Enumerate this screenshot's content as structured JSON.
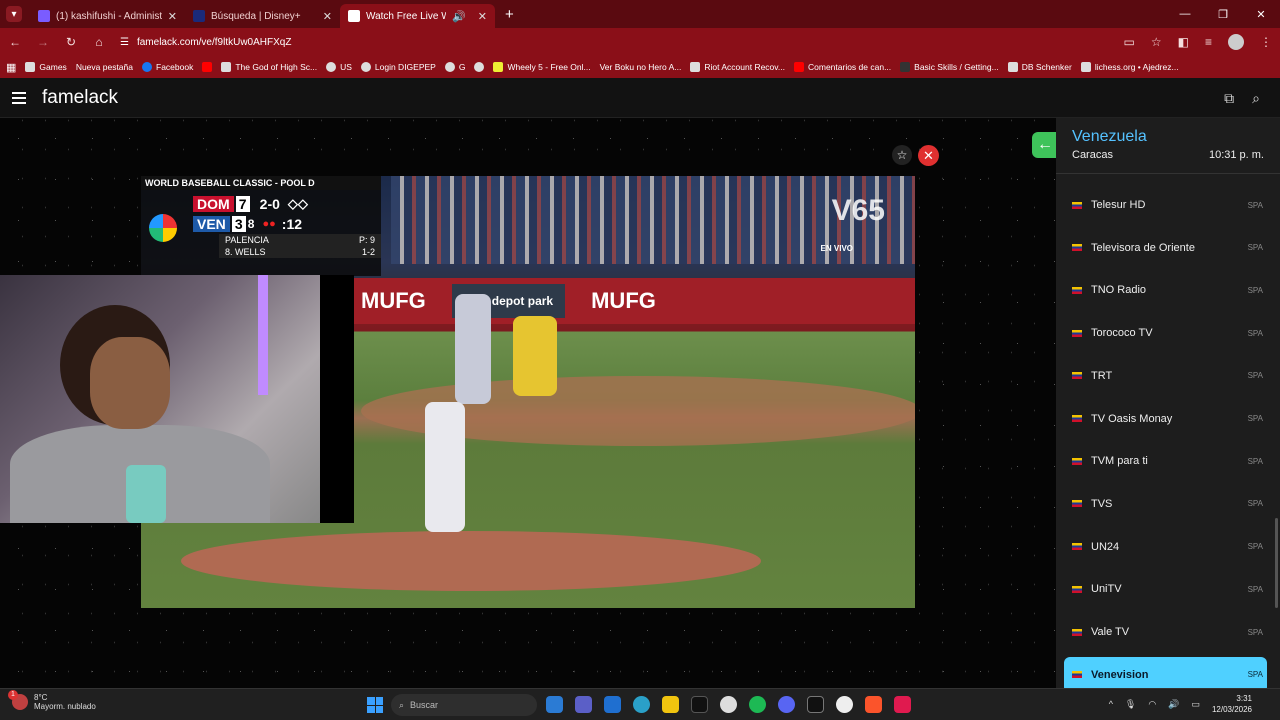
{
  "browser": {
    "tabs": [
      {
        "label": "(1) kashifushi - Administrador d",
        "active": false
      },
      {
        "label": "Búsqueda | Disney+",
        "active": false
      },
      {
        "label": "Watch Free Live World TV |",
        "active": true
      }
    ],
    "url": "famelack.com/ve/f9ltkUw0AHFXqZ",
    "bookmarks": [
      "Games",
      "Nueva pestaña",
      "Facebook",
      "",
      "The God of High Sc...",
      "US",
      "Login DIGEPEP",
      "G",
      "",
      "Wheely 5 - Free Onl...",
      "Ver Boku no Hero A...",
      "Riot Account Recov...",
      "Comentarios de can...",
      "Basic Skills / Getting...",
      "DB Schenker",
      "lichess.org • Ajedrez..."
    ]
  },
  "site": {
    "brand": "famelack"
  },
  "broadcast": {
    "header": "WORLD BASEBALL CLASSIC - POOL D",
    "team1": "DOM",
    "score1": "7",
    "team2": "VEN",
    "score2": "3",
    "inning": "8",
    "count": "2-0",
    "clock": ":12",
    "pitcher": "PALENCIA",
    "pitch_count": "P: 9",
    "batter": "8. WELLS",
    "batter_line": "1-2",
    "banner1": "MUFG",
    "banner2": "loan depot park",
    "banner3": "MUFG",
    "channel_logo": "V65",
    "live_label": "EN VIVO"
  },
  "sidebar": {
    "country": "Venezuela",
    "city": "Caracas",
    "time": "10:31 p. m.",
    "channels": [
      {
        "name": "Telesur HD",
        "lang": "SPA"
      },
      {
        "name": "Televisora de Oriente",
        "lang": "SPA"
      },
      {
        "name": "TNO Radio",
        "lang": "SPA"
      },
      {
        "name": "Torococo TV",
        "lang": "SPA"
      },
      {
        "name": "TRT",
        "lang": "SPA"
      },
      {
        "name": "TV Oasis Monay",
        "lang": "SPA"
      },
      {
        "name": "TVM para ti",
        "lang": "SPA"
      },
      {
        "name": "TVS",
        "lang": "SPA"
      },
      {
        "name": "UN24",
        "lang": "SPA"
      },
      {
        "name": "UniTV",
        "lang": "SPA"
      },
      {
        "name": "Vale TV",
        "lang": "SPA"
      },
      {
        "name": "Venevision",
        "lang": "SPA",
        "active": true
      }
    ]
  },
  "taskbar": {
    "temp": "8°C",
    "weather": "Mayorm. nublado",
    "weather_badge": "1",
    "search_placeholder": "Buscar",
    "time": "3:31",
    "date": "12/03/2026"
  },
  "colors": {
    "chrome_dark": "#5a0a10",
    "chrome": "#8a0f18",
    "accent_blue": "#55c2ff",
    "active_channel": "#4fd0ff",
    "close_red": "#e03030",
    "back_green": "#3ec35a"
  }
}
